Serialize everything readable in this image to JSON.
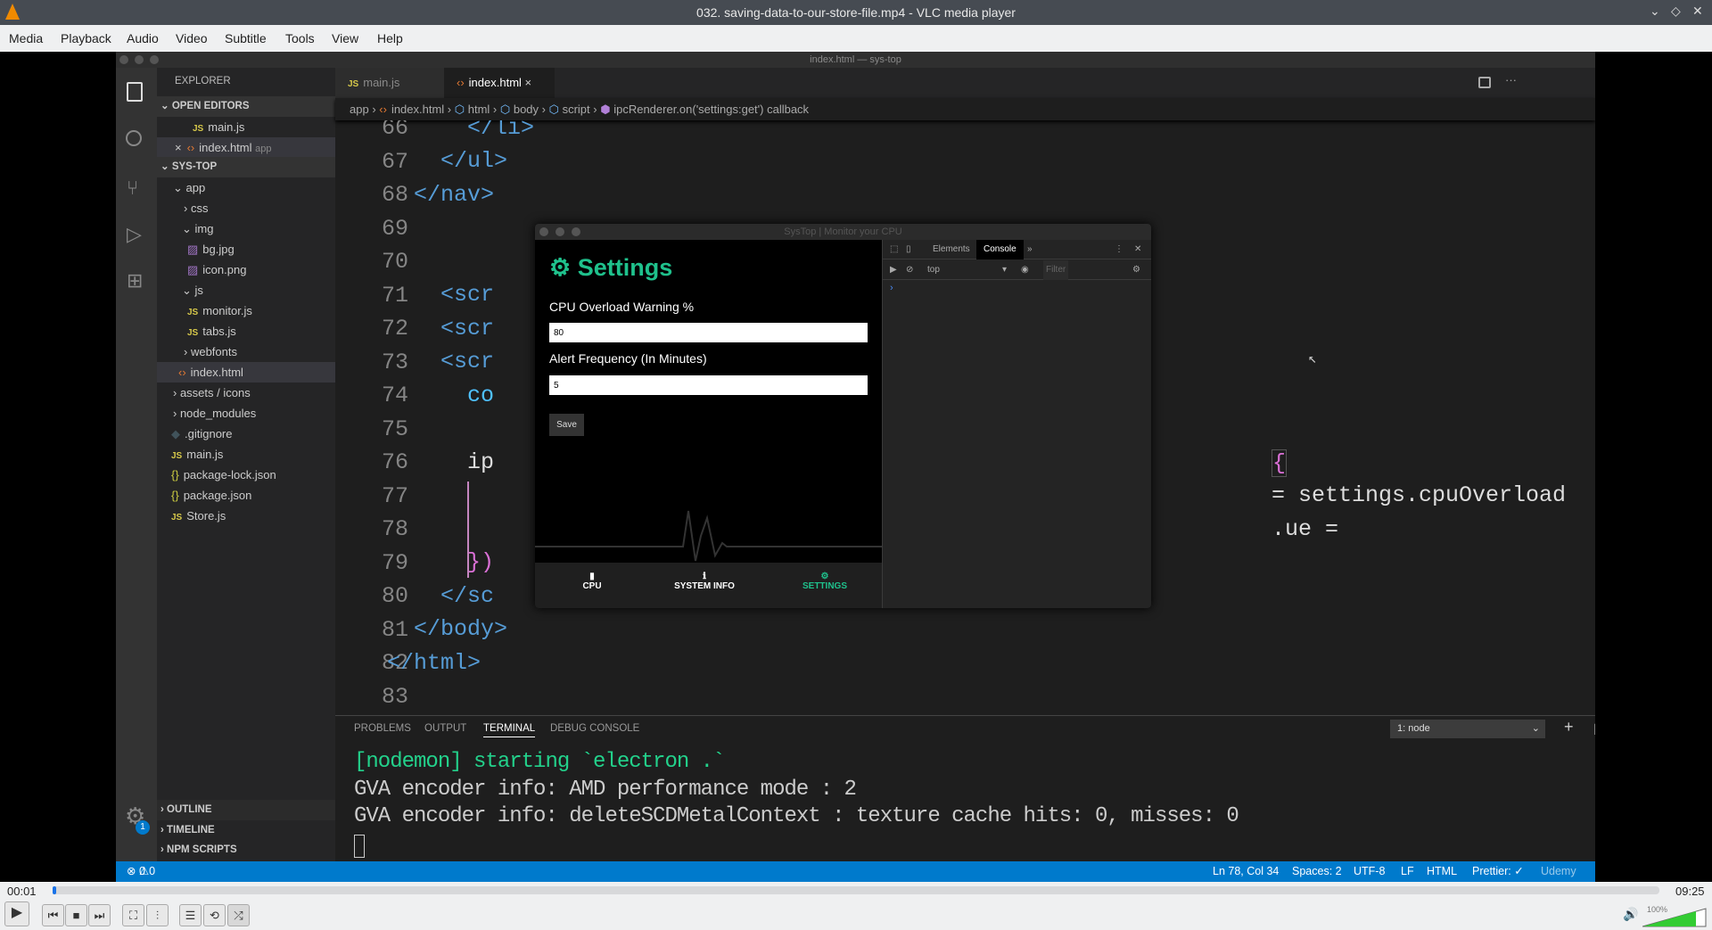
{
  "window": {
    "title": "032. saving-data-to-our-store-file.mp4 - VLC media player"
  },
  "menu": [
    "Media",
    "Playback",
    "Audio",
    "Video",
    "Subtitle",
    "Tools",
    "View",
    "Help"
  ],
  "vscode": {
    "window_title": "index.html — sys-top",
    "explorer_title": "EXPLORER",
    "open_editors": "OPEN EDITORS",
    "open_files": [
      {
        "name": "main.js"
      },
      {
        "name": "index.html",
        "hint": "app"
      }
    ],
    "project": "SYS-TOP",
    "tree": [
      "app",
      "css",
      "img",
      "bg.jpg",
      "icon.png",
      "js",
      "monitor.js",
      "tabs.js",
      "webfonts",
      "index.html",
      "assets / icons",
      "node_modules",
      ".gitignore",
      "main.js",
      "package-lock.json",
      "package.json",
      "Store.js"
    ],
    "bottom_sections": [
      "OUTLINE",
      "TIMELINE",
      "NPM SCRIPTS"
    ],
    "settings_badge": "1",
    "tabs": [
      {
        "label": "main.js"
      },
      {
        "label": "index.html",
        "active": true
      }
    ],
    "breadcrumb": [
      "app",
      "index.html",
      "html",
      "body",
      "script",
      "ipcRenderer.on('settings:get') callback"
    ],
    "line_numbers": [
      "66",
      "67",
      "68",
      "69",
      "70",
      "71",
      "72",
      "73",
      "74",
      "75",
      "76",
      "77",
      "78",
      "79",
      "80",
      "81",
      "82",
      "83"
    ],
    "code": {
      "l66": "</li>",
      "l67": "</ul>",
      "l68": "</nav>",
      "l70": "<scr",
      "l71": "<scr",
      "l72": "<scr",
      "l73": "co",
      "l75": "ip",
      "l75r": "{",
      "l76r": "= settings.cpuOverload",
      "l77r": ".ue =",
      "l79": "})",
      "l80": "</sc",
      "l81": "</body>",
      "l82": "</html>"
    },
    "panel_tabs": [
      "PROBLEMS",
      "OUTPUT",
      "TERMINAL",
      "DEBUG CONSOLE"
    ],
    "active_panel_tab": "TERMINAL",
    "terminal_select": "1: node",
    "terminal_lines": [
      "[nodemon] starting `electron .`",
      "GVA encoder info: AMD performance mode : 2",
      "GVA encoder info: deleteSCDMetalContext : texture cache hits: 0, misses: 0"
    ],
    "status": {
      "errors": "0",
      "warnings": "0",
      "position": "Ln 78, Col 34",
      "spaces": "Spaces: 2",
      "encoding": "UTF-8",
      "eol": "LF",
      "language": "HTML",
      "prettier": "Prettier: ✓"
    }
  },
  "app": {
    "title": "SysTop | Monitor your CPU",
    "heading": "Settings",
    "cpu_label": "CPU Overload Warning %",
    "cpu_value": "80",
    "freq_label": "Alert Frequency (In Minutes)",
    "freq_value": "5",
    "save": "Save",
    "nav": [
      "CPU",
      "SYSTEM INFO",
      "SETTINGS"
    ],
    "accent": "#1fc18c"
  },
  "devtools": {
    "tabs": [
      "Elements",
      "Console"
    ],
    "active": "Console",
    "context": "top",
    "filter": "Filter"
  },
  "watermark": "Udemy",
  "player": {
    "elapsed": "00:01",
    "duration": "09:25",
    "progress_fraction": 0.002,
    "volume": "100%",
    "volume_fraction": 1.0
  }
}
